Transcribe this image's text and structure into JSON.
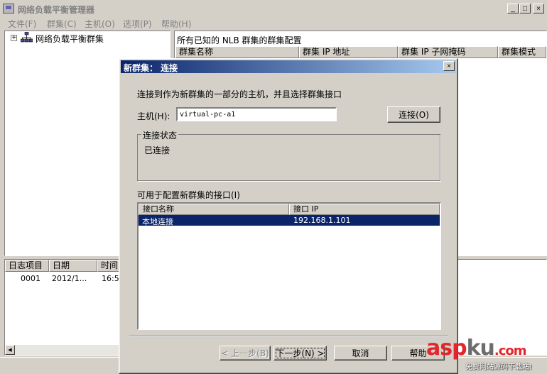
{
  "window": {
    "title": "网络负载平衡管理器",
    "min_glyph": "_",
    "max_glyph": "□",
    "close_glyph": "×"
  },
  "menu": {
    "items": [
      {
        "label": "文件(F)"
      },
      {
        "label": "群集(C)"
      },
      {
        "label": "主机(O)"
      },
      {
        "label": "选项(P)"
      },
      {
        "label": "帮助(H)"
      }
    ]
  },
  "tree": {
    "expander": "+",
    "root_label": "网络负载平衡群集"
  },
  "cluster_list": {
    "title": "所有已知的 NLB 群集的群集配置",
    "columns": [
      "群集名称",
      "群集 IP 地址",
      "群集 IP 子网掩码",
      "群集模式"
    ]
  },
  "log": {
    "columns": [
      "日志项目",
      "日期",
      "时间"
    ],
    "rows": [
      {
        "id": "0001",
        "date": "2012/1...",
        "time": "16:5"
      }
    ],
    "scroll_left_glyph": "◀"
  },
  "dialog": {
    "title": "新群集： 连接",
    "close_glyph": "×",
    "instruction": "连接到作为新群集的一部分的主机，并且选择群集接口",
    "host_label": "主机(H):",
    "host_value": "virtual-pc-a1",
    "connect_label": "连接(O)",
    "status_group_label": "连接状态",
    "status_text": "已连接",
    "interfaces_label": "可用于配置新群集的接口(I)",
    "interfaces": {
      "columns": [
        "接口名称",
        "接口 IP"
      ],
      "rows": [
        {
          "name": "本地连接",
          "ip": "192.168.1.101"
        }
      ]
    },
    "buttons": {
      "back": "< 上一步(B)",
      "next": "下一步(N) >",
      "cancel": "取消",
      "help": "帮助"
    }
  },
  "watermark": {
    "logo_a": "asp",
    "logo_b": "ku",
    "logo_c": ".com",
    "subtitle": "免费网站源码下载站!"
  },
  "colors": {
    "face": "#d4d0c8",
    "selection": "#0a246a",
    "title_gradient_end": "#a6caf0",
    "watermark_red": "#e3262b"
  }
}
